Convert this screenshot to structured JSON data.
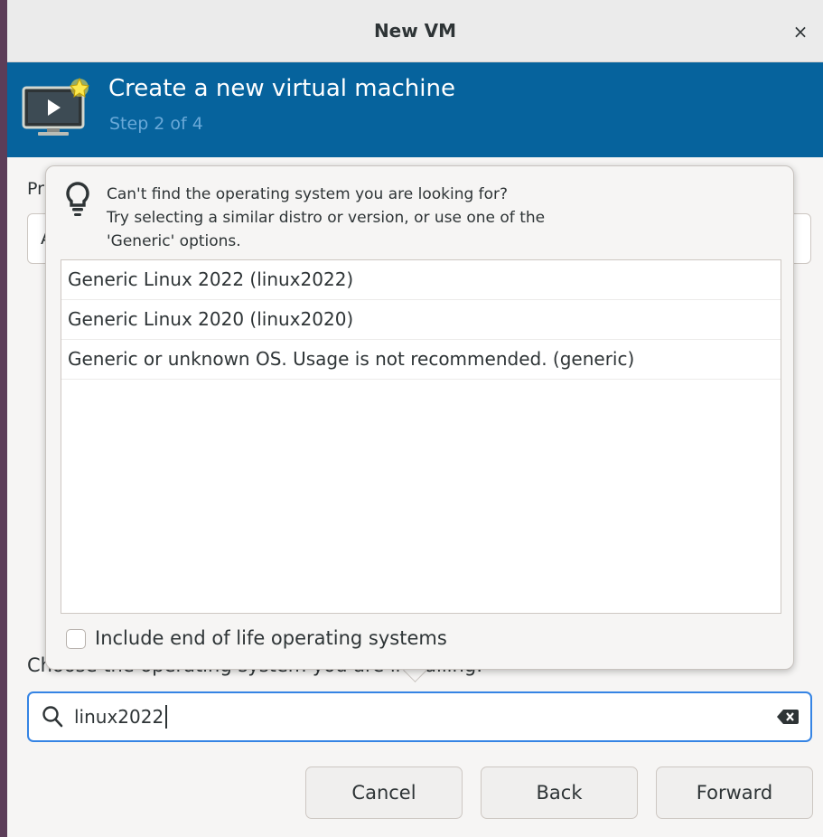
{
  "window": {
    "title": "New VM",
    "close_glyph": "×"
  },
  "banner": {
    "title": "Create a new virtual machine",
    "step": "Step 2 of 4",
    "icon": "vm-monitor-star-icon"
  },
  "background": {
    "os_label_partial": "Pr",
    "combo_partial": "A"
  },
  "popover": {
    "icon": "lightbulb-icon",
    "hint_lines": [
      "Can't find the operating system you are looking for?",
      "Try selecting a similar distro or version, or use one of the",
      "'Generic' options."
    ],
    "os_options": [
      "Generic Linux 2022 (linux2022)",
      "Generic Linux 2020 (linux2020)",
      "Generic or unknown OS. Usage is not recommended. (generic)"
    ],
    "eol_checkbox": {
      "label": "Include end of life operating systems",
      "checked": false
    }
  },
  "os_chooser": {
    "label": "Choose the operating system you are installing:",
    "search_value": "linux2022",
    "search_icon": "search-icon",
    "clear_icon": "clear-text-icon"
  },
  "buttons": {
    "cancel": "Cancel",
    "back": "Back",
    "forward": "Forward"
  },
  "colors": {
    "banner": "#06639d",
    "accent": "#3584e4",
    "step_text": "#6aa9d8"
  }
}
